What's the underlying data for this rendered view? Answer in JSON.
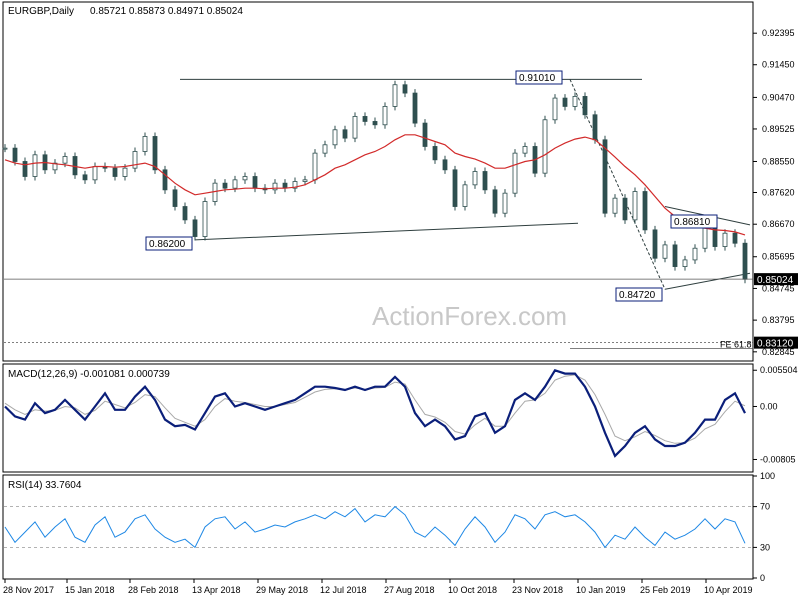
{
  "header": {
    "symbol": "EURGBP,Daily",
    "ohlc": "0.85721 0.85873 0.84971 0.85024"
  },
  "watermark": "ActionForex.com",
  "price_axis_labels": [
    "0.92395",
    "0.91450",
    "0.90470",
    "0.89525",
    "0.88550",
    "0.87620",
    "0.86670",
    "0.85695",
    "0.84745",
    "0.83795",
    "0.82845"
  ],
  "price_levels": [
    0.92395,
    0.9145,
    0.9047,
    0.89525,
    0.8855,
    0.8762,
    0.8667,
    0.85695,
    0.84745,
    0.83795,
    0.82845
  ],
  "current_price_badge": "0.85024",
  "fe_label": "FE 61.8",
  "fe_value_badge": "0.83120",
  "annotations": {
    "high": "0.91010",
    "low_left": "0.86200",
    "low_right": "0.84720",
    "mid_high": "0.86810"
  },
  "macd": {
    "label": "MACD(12,26,9) -0.001081 0.000739",
    "axis_labels": [
      "0.005504",
      "0.00",
      "-0.00805"
    ],
    "axis_values": [
      0.005504,
      0.0,
      -0.00805
    ]
  },
  "rsi": {
    "label": "RSI(14) 33.7604",
    "axis_labels": [
      "100",
      "70",
      "30",
      "0"
    ],
    "axis_values": [
      100,
      70,
      30,
      0
    ]
  },
  "date_labels": [
    "28 Nov 2017",
    "15 Jan 2018",
    "28 Feb 2018",
    "13 Apr 2018",
    "29 May 2018",
    "12 Jul 2018",
    "27 Aug 2018",
    "10 Oct 2018",
    "23 Nov 2018",
    "10 Jan 2019",
    "25 Feb 2019",
    "10 Apr 2019"
  ],
  "colors": {
    "candles": "#2f4f4f",
    "ma": "#d22a2a",
    "macd_main": "#0b1f7a",
    "macd_signal": "#a9a9a9",
    "rsi": "#1e88e5",
    "trendline": "#2f3f3f",
    "badge_bg": "#ffffff",
    "badge_border": "#0b1f7a",
    "current_badge_bg": "#000000",
    "current_badge_text": "#ffffff"
  },
  "chart_data": {
    "type": "line",
    "main": {
      "x": [
        0,
        10,
        20,
        30,
        40,
        50,
        60,
        70,
        80,
        90,
        100,
        110,
        120,
        130,
        140,
        150,
        160,
        170,
        180,
        190,
        200,
        210,
        220,
        230,
        240,
        250,
        260,
        270,
        280,
        290,
        300,
        310,
        320,
        330,
        340,
        350,
        360,
        370,
        380,
        390,
        400,
        410,
        420,
        430,
        440,
        450,
        460,
        470,
        480,
        490,
        500,
        510,
        520,
        530,
        540,
        550,
        560,
        570,
        580,
        590,
        600,
        610,
        620,
        630,
        640,
        650,
        660,
        670,
        680,
        690,
        700,
        710,
        720,
        730,
        740
      ],
      "close": [
        0.8895,
        0.8855,
        0.881,
        0.8875,
        0.883,
        0.885,
        0.887,
        0.8815,
        0.88,
        0.884,
        0.8835,
        0.881,
        0.8835,
        0.8885,
        0.893,
        0.883,
        0.877,
        0.872,
        0.868,
        0.863,
        0.8735,
        0.879,
        0.8775,
        0.88,
        0.881,
        0.8775,
        0.877,
        0.879,
        0.8775,
        0.8795,
        0.88,
        0.888,
        0.8905,
        0.895,
        0.8925,
        0.899,
        0.8975,
        0.8965,
        0.902,
        0.9085,
        0.906,
        0.897,
        0.89,
        0.886,
        0.883,
        0.872,
        0.8785,
        0.8825,
        0.877,
        0.87,
        0.876,
        0.888,
        0.89,
        0.882,
        0.898,
        0.9045,
        0.902,
        0.905,
        0.8995,
        0.892,
        0.87,
        0.8745,
        0.868,
        0.8765,
        0.865,
        0.8565,
        0.8605,
        0.854,
        0.856,
        0.8595,
        0.8655,
        0.86,
        0.864,
        0.861,
        0.8502
      ],
      "ma": [
        0.886,
        0.885,
        0.8845,
        0.885,
        0.8852,
        0.8848,
        0.8845,
        0.884,
        0.8835,
        0.884,
        0.884,
        0.8838,
        0.884,
        0.8845,
        0.885,
        0.884,
        0.8815,
        0.879,
        0.877,
        0.8755,
        0.876,
        0.8765,
        0.877,
        0.8772,
        0.8775,
        0.8775,
        0.8773,
        0.8775,
        0.8775,
        0.8778,
        0.8785,
        0.88,
        0.8815,
        0.8835,
        0.8845,
        0.886,
        0.8875,
        0.8885,
        0.89,
        0.892,
        0.8935,
        0.8935,
        0.8925,
        0.8915,
        0.8905,
        0.888,
        0.887,
        0.8862,
        0.885,
        0.8835,
        0.8835,
        0.8845,
        0.8855,
        0.886,
        0.8875,
        0.8895,
        0.891,
        0.8922,
        0.8928,
        0.892,
        0.8895,
        0.8868,
        0.884,
        0.8815,
        0.8785,
        0.875,
        0.8715,
        0.869,
        0.8672,
        0.866,
        0.8655,
        0.865,
        0.8648,
        0.8644,
        0.8635
      ],
      "ylim": [
        0.826,
        0.933
      ]
    },
    "macd": {
      "x": [
        0,
        10,
        20,
        30,
        40,
        50,
        60,
        70,
        80,
        90,
        100,
        110,
        120,
        130,
        140,
        150,
        160,
        170,
        180,
        190,
        200,
        210,
        220,
        230,
        240,
        250,
        260,
        270,
        280,
        290,
        300,
        310,
        320,
        330,
        340,
        350,
        360,
        370,
        380,
        390,
        400,
        410,
        420,
        430,
        440,
        450,
        460,
        470,
        480,
        490,
        500,
        510,
        520,
        530,
        540,
        550,
        560,
        570,
        580,
        590,
        600,
        610,
        620,
        630,
        640,
        650,
        660,
        670,
        680,
        690,
        700,
        710,
        720,
        730,
        740
      ],
      "main": [
        0.0,
        -0.0015,
        -0.002,
        0.0005,
        -0.001,
        -0.0005,
        0.001,
        -0.0005,
        -0.002,
        0.0,
        0.002,
        -0.0005,
        -0.0005,
        0.0015,
        0.003,
        0.001,
        -0.002,
        -0.003,
        -0.0028,
        -0.0035,
        -0.001,
        0.0015,
        0.002,
        0.0,
        0.0005,
        0.0,
        -0.0005,
        0.0,
        0.0005,
        0.001,
        0.002,
        0.003,
        0.003,
        0.0028,
        0.0025,
        0.003,
        0.0025,
        0.003,
        0.003,
        0.0045,
        0.003,
        -0.001,
        -0.003,
        -0.002,
        -0.003,
        -0.005,
        -0.0045,
        -0.0015,
        -0.001,
        -0.004,
        -0.003,
        0.001,
        0.002,
        0.001,
        0.003,
        0.0055,
        0.005,
        0.005,
        0.003,
        0.0,
        -0.004,
        -0.0075,
        -0.006,
        -0.004,
        -0.003,
        -0.005,
        -0.006,
        -0.006,
        -0.0055,
        -0.004,
        -0.002,
        -0.002,
        0.001,
        0.002,
        -0.001
      ],
      "signal": [
        0.0005,
        -0.0005,
        -0.0012,
        -0.0005,
        -0.0007,
        -0.0006,
        0.0,
        -0.0002,
        -0.0012,
        -0.0006,
        0.0008,
        0.0003,
        -0.0002,
        0.0006,
        0.0018,
        0.0015,
        -0.0002,
        -0.0018,
        -0.0024,
        -0.003,
        -0.002,
        0.0,
        0.0012,
        0.0008,
        0.0006,
        0.0003,
        0.0,
        0.0,
        0.0003,
        0.0006,
        0.0014,
        0.0022,
        0.0026,
        0.0027,
        0.0026,
        0.0028,
        0.0026,
        0.0028,
        0.0029,
        0.0037,
        0.0034,
        0.001,
        -0.0012,
        -0.0016,
        -0.0024,
        -0.0038,
        -0.0042,
        -0.0028,
        -0.0018,
        -0.003,
        -0.003,
        -0.001,
        0.0008,
        0.001,
        0.002,
        0.004,
        0.0046,
        0.0048,
        0.004,
        0.0018,
        -0.0012,
        -0.0045,
        -0.0052,
        -0.0046,
        -0.0038,
        -0.0044,
        -0.0052,
        -0.0056,
        -0.0055,
        -0.0048,
        -0.0034,
        -0.0027,
        -0.0008,
        0.0008,
        0.0001
      ],
      "ylim": [
        -0.0098,
        0.0063
      ]
    },
    "rsi": {
      "x": [
        0,
        10,
        20,
        30,
        40,
        50,
        60,
        70,
        80,
        90,
        100,
        110,
        120,
        130,
        140,
        150,
        160,
        170,
        180,
        190,
        200,
        210,
        220,
        230,
        240,
        250,
        260,
        270,
        280,
        290,
        300,
        310,
        320,
        330,
        340,
        350,
        360,
        370,
        380,
        390,
        400,
        410,
        420,
        430,
        440,
        450,
        460,
        470,
        480,
        490,
        500,
        510,
        520,
        530,
        540,
        550,
        560,
        570,
        580,
        590,
        600,
        610,
        620,
        630,
        640,
        650,
        660,
        670,
        680,
        690,
        700,
        710,
        720,
        730,
        740
      ],
      "values": [
        50,
        35,
        45,
        55,
        40,
        50,
        58,
        40,
        35,
        52,
        60,
        40,
        45,
        58,
        62,
        48,
        40,
        35,
        38,
        30,
        50,
        58,
        60,
        48,
        55,
        45,
        48,
        52,
        50,
        55,
        58,
        62,
        58,
        65,
        60,
        68,
        55,
        62,
        60,
        70,
        62,
        45,
        40,
        50,
        42,
        32,
        48,
        60,
        50,
        35,
        45,
        62,
        58,
        48,
        62,
        65,
        60,
        62,
        55,
        45,
        30,
        42,
        38,
        50,
        40,
        32,
        45,
        38,
        42,
        48,
        58,
        48,
        58,
        55,
        34
      ],
      "ylim": [
        0,
        100
      ],
      "levels": [
        70,
        30
      ]
    }
  }
}
